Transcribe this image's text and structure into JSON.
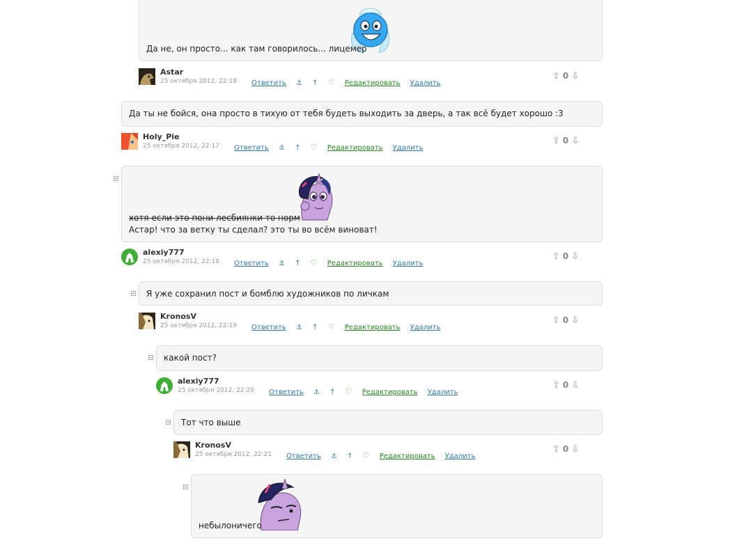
{
  "labels": {
    "reply": "Ответить",
    "edit": "Редактировать",
    "delete": "Удалить"
  },
  "comments": [
    {
      "author": "Astar",
      "date": "25 октября 2012, 22:18",
      "text": "Да не, он просто... как там говорилось... лицемер",
      "votes": "0"
    },
    {
      "author": "Holy_Pie",
      "date": "25 октября 2012, 22:17",
      "text": "Да ты не бойся, она просто в тихую от тебя будеть выходить за дверь, а так всё будет хорошо :3",
      "votes": "0"
    },
    {
      "author": "alexiy777",
      "date": "25 октября 2012, 22:18",
      "text_struck": "хотя если это пони лесбиянки то норм",
      "text": "Астар! что за ветку ты сделал? это ты во всём виноват!",
      "votes": "0"
    },
    {
      "author": "KronosV",
      "date": "25 октября 2012, 22:19",
      "text": "Я уже сохранил пост и бомблю художников по личкам",
      "votes": "0"
    },
    {
      "author": "alexiy777",
      "date": "25 октября 2012, 22:20",
      "text": "какой пост?",
      "votes": "0"
    },
    {
      "author": "KronosV",
      "date": "25 октября 2012, 22:21",
      "text": "Тот что выше",
      "votes": "0"
    },
    {
      "text": "небылоничего"
    }
  ],
  "colors": {
    "link": "#2b78b5",
    "edit_link": "#238a1c",
    "bubble_bg": "#f5f5f5",
    "bubble_border": "#dedede"
  }
}
